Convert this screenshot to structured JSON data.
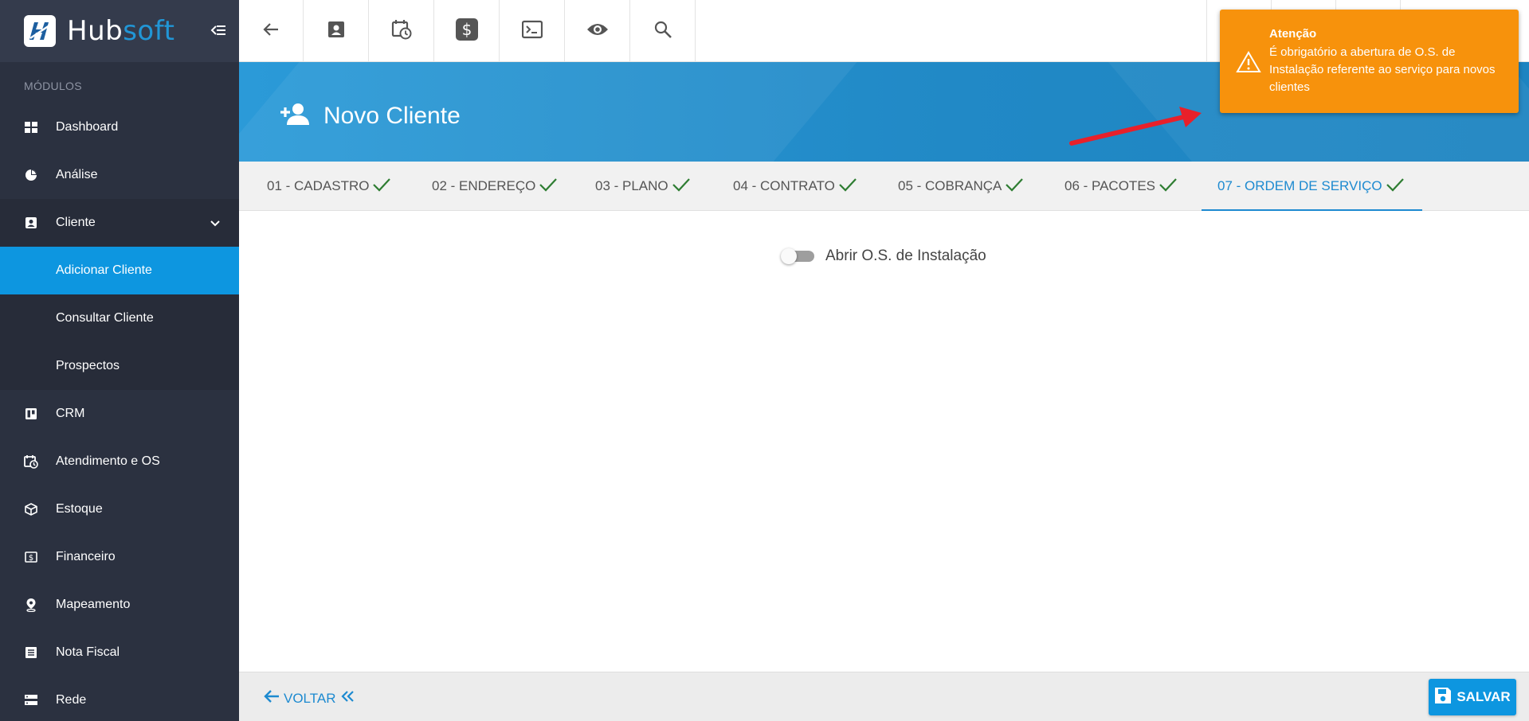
{
  "brand": {
    "name_part1": "Hub",
    "name_part2": "soft"
  },
  "sidebar": {
    "section_label": "MÓDULOS",
    "items": [
      {
        "label": "Dashboard",
        "icon": "dashboard-icon"
      },
      {
        "label": "Análise",
        "icon": "pie-chart-icon"
      },
      {
        "label": "Cliente",
        "icon": "contact-card-icon",
        "expanded": true,
        "children": [
          {
            "label": "Adicionar Cliente",
            "active": true
          },
          {
            "label": "Consultar Cliente"
          },
          {
            "label": "Prospectos"
          }
        ]
      },
      {
        "label": "CRM",
        "icon": "trello-board-icon"
      },
      {
        "label": "Atendimento e OS",
        "icon": "calendar-clock-icon"
      },
      {
        "label": "Estoque",
        "icon": "package-icon"
      },
      {
        "label": "Financeiro",
        "icon": "money-icon"
      },
      {
        "label": "Mapeamento",
        "icon": "map-pin-icon"
      },
      {
        "label": "Nota Fiscal",
        "icon": "receipt-icon"
      },
      {
        "label": "Rede",
        "icon": "server-icon"
      }
    ]
  },
  "toolbar": {
    "icons": [
      "back-arrow-icon",
      "contact-card-icon",
      "calendar-clock-icon",
      "dollar-icon",
      "terminal-icon",
      "eye-icon",
      "search-icon"
    ]
  },
  "header": {
    "title": "Novo Cliente",
    "icon": "person-add-icon"
  },
  "steps": [
    {
      "label": "01 - CADASTRO",
      "done": true
    },
    {
      "label": "02 - ENDEREÇO",
      "done": true
    },
    {
      "label": "03 - PLANO",
      "done": true
    },
    {
      "label": "04 - CONTRATO",
      "done": true
    },
    {
      "label": "05 - COBRANÇA",
      "done": true
    },
    {
      "label": "06 - PACOTES",
      "done": true
    },
    {
      "label": "07 - ORDEM DE SERVIÇO",
      "done": true,
      "active": true
    }
  ],
  "content": {
    "toggle_label": "Abrir O.S. de Instalação",
    "toggle_on": false
  },
  "footer": {
    "back_label": "VOLTAR",
    "save_label": "SALVAR"
  },
  "toast": {
    "title": "Atenção",
    "message": "É obrigatório a abertura de O.S. de Instalação referente ao serviço para novos clientes"
  },
  "colors": {
    "accent": "#0d96e0",
    "sidebar": "#2b3140",
    "toast": "#f7920c",
    "check": "#2e7d32",
    "annotation": "#e8202a"
  }
}
